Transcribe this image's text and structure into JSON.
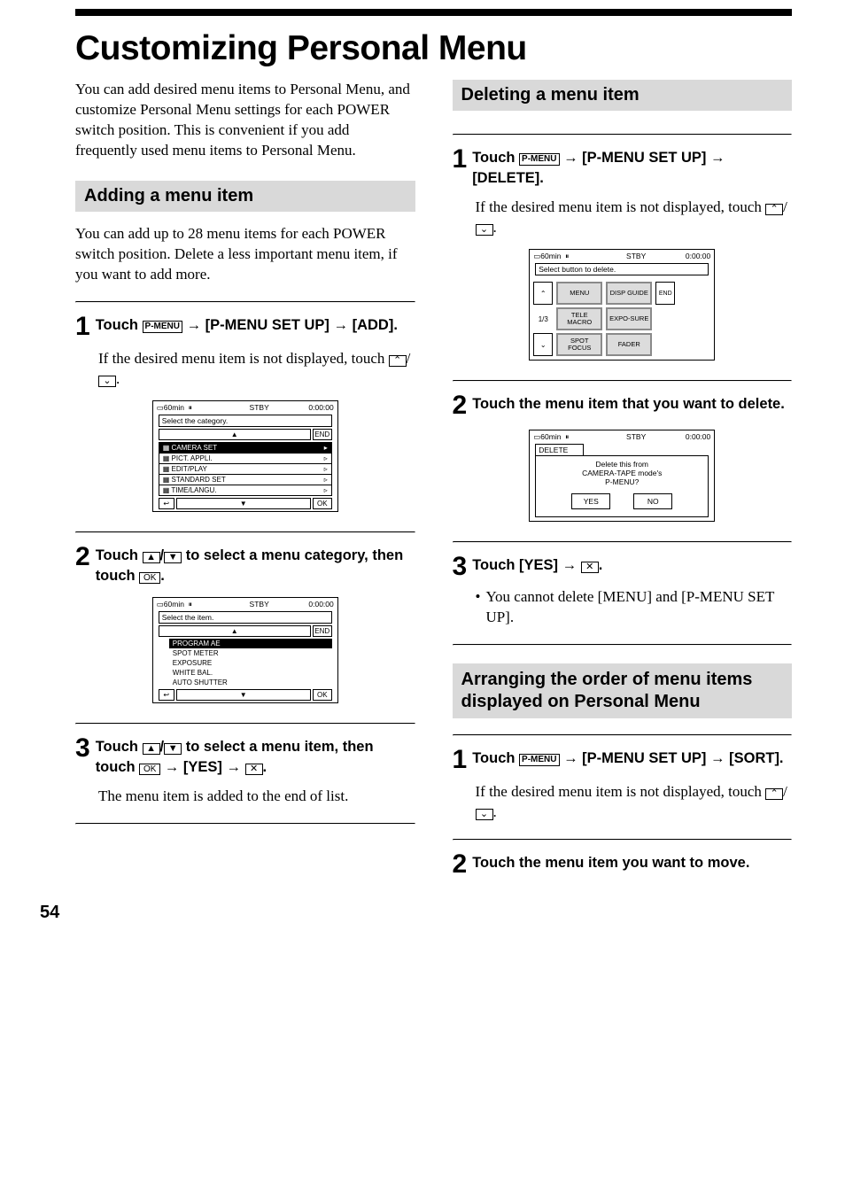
{
  "title": "Customizing Personal Menu",
  "intro": "You can add desired menu items to Personal Menu, and customize Personal Menu settings for each POWER switch position. This is convenient if you add frequently used menu items to Personal Menu.",
  "pageNumber": "54",
  "add": {
    "heading": "Adding a menu item",
    "intro": "You can add up to 28 menu items for each POWER switch position. Delete a less important menu item, if you want to add more.",
    "step1_pre": "Touch ",
    "pmenu": "P-MENU",
    "step1_post": " [P-MENU SET UP]  [ADD].",
    "step1_note_a": "If the desired menu item is not displayed, touch ",
    "step1_note_b": ".",
    "step2_a": "Touch ",
    "step2_b": " to select a menu category, then touch ",
    "ok": "OK",
    "step3_a": "Touch ",
    "step3_b": " to select a menu item, then touch ",
    "step3_c": " [YES]  ",
    "step3_note": "The menu item is added to the end of list."
  },
  "del": {
    "heading": "Deleting a menu item",
    "step1_pre": "Touch ",
    "step1_post": " [P-MENU SET UP]  [DELETE].",
    "step1_note_a": "If the desired menu item is not displayed, touch ",
    "step2": "Touch the menu item that you want to delete.",
    "step3_a": "Touch [YES]  ",
    "step3_note": "You cannot delete [MENU] and [P-MENU SET UP]."
  },
  "sort": {
    "heading": "Arranging the order of menu items displayed on Personal Menu",
    "step1_pre": "Touch ",
    "step1_post": " [P-MENU SET UP]  [SORT].",
    "step1_note_a": "If the desired menu item is not displayed, touch ",
    "step2": "Touch the menu item you want to move."
  },
  "fig1": {
    "rec": "60min",
    "status": "STBY",
    "time": "0:00:00",
    "sub": "Select the category.",
    "end": "END",
    "cat1": "CAMERA SET",
    "cat2": "PICT. APPLI.",
    "cat3": "EDIT/PLAY",
    "cat4": "STANDARD SET",
    "cat5": "TIME/LANGU.",
    "ok": "OK"
  },
  "fig2": {
    "rec": "60min",
    "status": "STBY",
    "time": "0:00:00",
    "sub": "Select the item.",
    "end": "END",
    "i1": "PROGRAM AE",
    "i2": "SPOT METER",
    "i3": "EXPOSURE",
    "i4": "WHITE BAL.",
    "i5": "AUTO SHUTTER",
    "ok": "OK"
  },
  "fig3": {
    "rec": "60min",
    "status": "STBY",
    "time": "0:00:00",
    "sub": "Select button to delete.",
    "end": "END",
    "page": "1/3",
    "b1": "MENU",
    "b2": "DISP GUIDE",
    "b3": "TELE MACRO",
    "b4": "EXPO-SURE",
    "b5": "SPOT FOCUS",
    "b6": "FADER"
  },
  "fig4": {
    "rec": "60min",
    "status": "STBY",
    "time": "0:00:00",
    "tab": "DELETE",
    "msg1": "Delete this from",
    "msg2": "CAMERA-TAPE mode's",
    "msg3": "P-MENU?",
    "yes": "YES",
    "no": "NO"
  },
  "arrows": {
    "right": "→",
    "up": "▲",
    "dn": "▼",
    "dblup": "⌃",
    "dbldn": "⌄",
    "x": "✕",
    "back": "↩"
  }
}
